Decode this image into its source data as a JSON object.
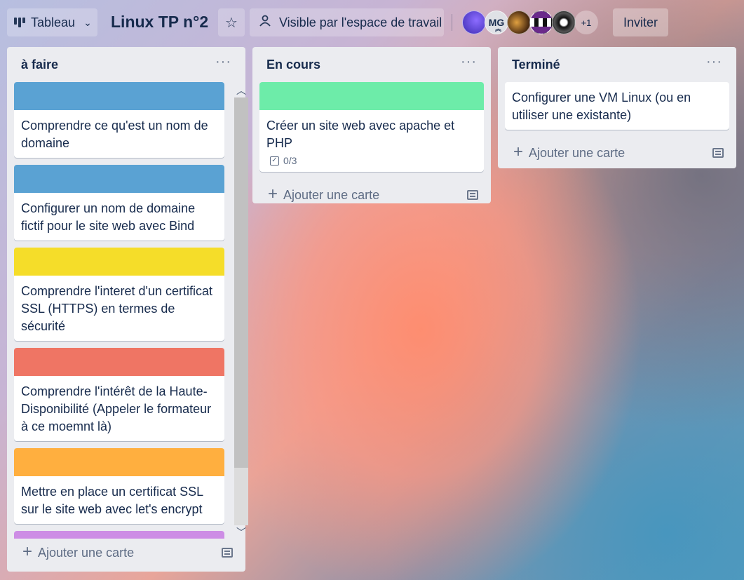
{
  "header": {
    "view_label": "Tableau",
    "board_title": "Linux TP n°2",
    "visibility_label": "Visible par l'espace de travail",
    "avatar_initials": "MG",
    "more_members": "+1",
    "invite_label": "Inviter"
  },
  "lists": [
    {
      "title": "à faire",
      "menu": "···",
      "add_card": "Ajouter une carte",
      "cards": [
        {
          "text": "Comprendre ce qu'est un nom de domaine",
          "cover": "#5aa2d3"
        },
        {
          "text": "Configurer un nom de domaine fictif pour le site web avec Bind",
          "cover": "#5aa2d3"
        },
        {
          "text": "Comprendre l'interet d'un certificat SSL (HTTPS) en termes de sécurité",
          "cover": "#f5dd29"
        },
        {
          "text": "Comprendre l'intérêt de la Haute-Disponibilité (Appeler le formateur à ce moemnt là)",
          "cover": "#ef7564"
        },
        {
          "text": "Mettre en place un certificat SSL sur le site web avec let's encrypt",
          "cover": "#ffaf3f"
        },
        {
          "text": "",
          "cover": "#cd8de5"
        }
      ]
    },
    {
      "title": "En cours",
      "menu": "···",
      "add_card": "Ajouter une carte",
      "cards": [
        {
          "text": "Créer un site web avec apache et PHP",
          "cover": "#6deca9",
          "checklist": "0/3"
        }
      ]
    },
    {
      "title": "Terminé",
      "menu": "···",
      "add_card": "Ajouter une carte",
      "cards": [
        {
          "text": "Configurer une VM Linux (ou en utiliser une existante)"
        }
      ]
    }
  ]
}
